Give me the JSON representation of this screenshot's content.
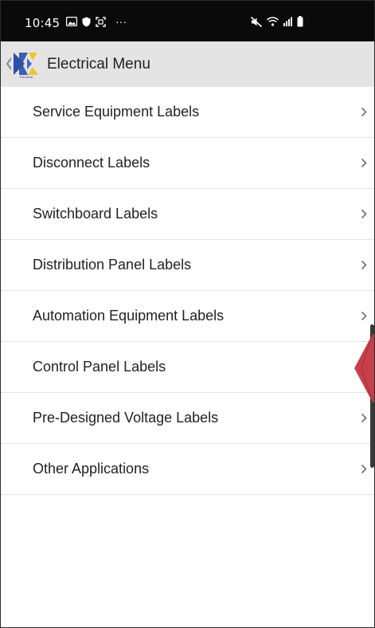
{
  "status_bar": {
    "time": "10:45",
    "left_icons": [
      "gallery-icon",
      "shield-icon",
      "screenshot-icon",
      "more-icon"
    ],
    "right_icons": [
      "mute-icon",
      "wifi-icon",
      "signal-icon",
      "battery-icon"
    ],
    "more_glyph": "···"
  },
  "app_bar": {
    "title": "Electrical Menu",
    "logo_caption": "Electrical"
  },
  "menu": {
    "items": [
      {
        "label": "Service Equipment Labels"
      },
      {
        "label": "Disconnect Labels"
      },
      {
        "label": "Switchboard Labels"
      },
      {
        "label": "Distribution Panel Labels"
      },
      {
        "label": "Automation Equipment Labels"
      },
      {
        "label": "Control Panel Labels"
      },
      {
        "label": "Pre-Designed Voltage Labels"
      },
      {
        "label": "Other Applications"
      }
    ]
  },
  "colors": {
    "status_bar": "#0a0a0a",
    "app_bar": "#e4e4e4",
    "edge_handle": "#c6404a",
    "logo_blue": "#2e4fa8",
    "logo_yellow": "#f2c230"
  }
}
